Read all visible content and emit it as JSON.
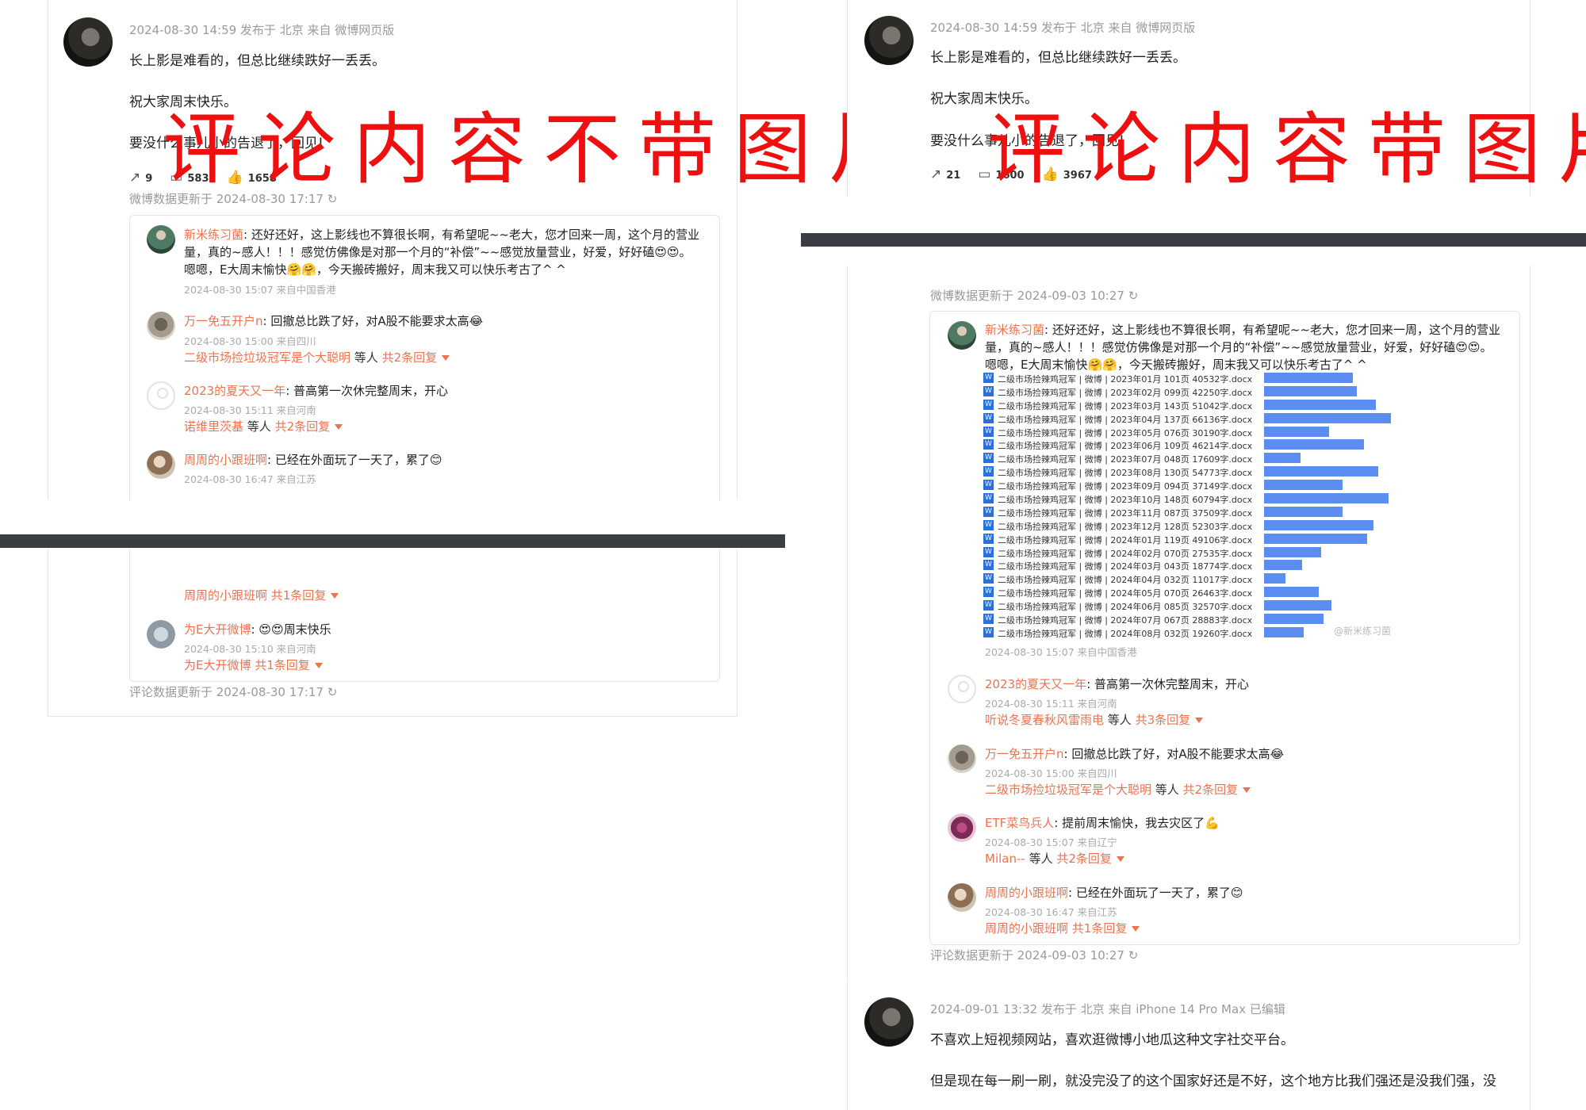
{
  "left": {
    "post": {
      "meta": "2024-08-30 14:59 发布于 北京 来自 微博网页版",
      "lines": [
        "长上影是难看的，但总比继续跌好一丢丢。",
        "祝大家周末快乐。",
        "要没什么事儿小的告退了，回见!"
      ],
      "reposts": "9",
      "comments": "583",
      "likes": "1658",
      "updated": "微博数据更新于 2024-08-30 17:17"
    },
    "overlay": "评论内容不带图片",
    "comments": [
      {
        "user": "新米练习菌",
        "text": ": 还好还好，这上影线也不算很长啊，有希望呢~~老大，您才回来一周，这个月的营业",
        "text2": "量，真的~感人！！！感觉仿佛像是对那一个月的“补偿”~~感觉放量营业，好爱，好好磕😍😍。",
        "text3": "嗯嗯，E大周末愉快🤗🤗，今天搬砖搬好，周末我又可以快乐考古了^ ^",
        "meta": "2024-08-30 15:07 来自中国香港"
      },
      {
        "user": "万一免五开户n",
        "text": ": 回撤总比跌了好，对A股不能要求太高😂",
        "meta": "2024-08-30 15:00 来自四川",
        "reply_user": "二级市场捡垃圾冠军是个大聪明",
        "reply_mid": " 等人 ",
        "reply_count": "共2条回复"
      },
      {
        "user": "2023的夏天又一年",
        "text": ": 普高第一次休完整周末，开心",
        "meta": "2024-08-30 15:11 来自河南",
        "reply_user": "诺维里茨基",
        "reply_mid": " 等人 ",
        "reply_count": "共2条回复"
      },
      {
        "user": "周周的小跟班啊",
        "text": ": 已经在外面玩了一天了，累了😊",
        "meta": "2024-08-30 16:47 来自江苏"
      }
    ],
    "bottom": {
      "reply1": "周周的小跟班啊 共1条回复",
      "comment_user": "为E大开微博",
      "comment_text": ": 😍😍周末快乐",
      "comment_meta": "2024-08-30 15:10 来自河南",
      "reply2": "为E大开微博 共1条回复",
      "updated": "评论数据更新于 2024-08-30 17:17"
    }
  },
  "right": {
    "post": {
      "meta": "2024-08-30 14:59 发布于 北京 来自 微博网页版",
      "lines": [
        "长上影是难看的，但总比继续跌好一丢丢。",
        "祝大家周末快乐。",
        "要没什么事儿小的告退了，回见!"
      ],
      "reposts": "21",
      "comments": "1600",
      "likes": "3967"
    },
    "overlay": "评论内容带图片",
    "updated_top": "微博数据更新于 2024-09-03 10:27",
    "first_comment": {
      "user": "新米练习菌",
      "text": ": 还好还好，这上影线也不算很长啊，有希望呢~~老大，您才回来一周，这个月的营业",
      "text2": "量，真的~感人！！！感觉仿佛像是对那一个月的“补偿”~~感觉放量营业，好爱，好好磕😍😍。",
      "text3": "嗯嗯，E大周末愉快🤗🤗，今天搬砖搬好，周末我又可以快乐考古了^ ^",
      "meta": "2024-08-30 15:07 来自中国香港",
      "image_watermark": "@新米练习菌"
    },
    "files": [
      {
        "name": "二级市场捡辣鸡冠军 | 微博 | 2023年01月 101页 40532字.docx",
        "bar": 0.7
      },
      {
        "name": "二级市场捡辣鸡冠军 | 微博 | 2023年02月 099页 42250字.docx",
        "bar": 0.73
      },
      {
        "name": "二级市场捡辣鸡冠军 | 微博 | 2023年03月 143页 51042字.docx",
        "bar": 0.88
      },
      {
        "name": "二级市场捡辣鸡冠军 | 微博 | 2023年04月 137页 66136字.docx",
        "bar": 1.0
      },
      {
        "name": "二级市场捡辣鸡冠军 | 微博 | 2023年05月 076页 30190字.docx",
        "bar": 0.51
      },
      {
        "name": "二级市场捡辣鸡冠军 | 微博 | 2023年06月 109页 46214字.docx",
        "bar": 0.79
      },
      {
        "name": "二级市场捡辣鸡冠军 | 微博 | 2023年07月 048页 17609字.docx",
        "bar": 0.29
      },
      {
        "name": "二级市场捡辣鸡冠军 | 微博 | 2023年08月 130页 54773字.docx",
        "bar": 0.9
      },
      {
        "name": "二级市场捡辣鸡冠军 | 微博 | 2023年09月 094页 37149字.docx",
        "bar": 0.62
      },
      {
        "name": "二级市场捡辣鸡冠军 | 微博 | 2023年10月 148页 60794字.docx",
        "bar": 0.98
      },
      {
        "name": "二级市场捡辣鸡冠军 | 微博 | 2023年11月 087页 37509字.docx",
        "bar": 0.62
      },
      {
        "name": "二级市场捡辣鸡冠军 | 微博 | 2023年12月 128页 52303字.docx",
        "bar": 0.86
      },
      {
        "name": "二级市场捡辣鸡冠军 | 微博 | 2024年01月 119页 49106字.docx",
        "bar": 0.81
      },
      {
        "name": "二级市场捡辣鸡冠军 | 微博 | 2024年02月 070页 27535字.docx",
        "bar": 0.45
      },
      {
        "name": "二级市场捡辣鸡冠军 | 微博 | 2024年03月 043页 18774字.docx",
        "bar": 0.3
      },
      {
        "name": "二级市场捡辣鸡冠军 | 微博 | 2024年04月 032页 11017字.docx",
        "bar": 0.17
      },
      {
        "name": "二级市场捡辣鸡冠军 | 微博 | 2024年05月 070页 26463字.docx",
        "bar": 0.43
      },
      {
        "name": "二级市场捡辣鸡冠军 | 微博 | 2024年06月 085页 32570字.docx",
        "bar": 0.53
      },
      {
        "name": "二级市场捡辣鸡冠军 | 微博 | 2024年07月 067页 28883字.docx",
        "bar": 0.47
      },
      {
        "name": "二级市场捡辣鸡冠军 | 微博 | 2024年08月 032页 19260字.docx",
        "bar": 0.31
      }
    ],
    "comments": [
      {
        "user": "2023的夏天又一年",
        "text": ": 普高第一次休完整周末，开心",
        "meta": "2024-08-30 15:11 来自河南",
        "reply_user": "听说冬夏春秋风雷雨电",
        "reply_mid": " 等人 ",
        "reply_count": "共3条回复"
      },
      {
        "user": "万一免五开户n",
        "text": ": 回撤总比跌了好，对A股不能要求太高😂",
        "meta": "2024-08-30 15:00 来自四川",
        "reply_user": "二级市场捡垃圾冠军是个大聪明",
        "reply_mid": " 等人 ",
        "reply_count": "共2条回复"
      },
      {
        "user": "ETF菜鸟兵人",
        "text": ": 提前周末愉快，我去灾区了💪",
        "meta": "2024-08-30 15:07 来自辽宁",
        "reply_user": "Milan--",
        "reply_mid": " 等人 ",
        "reply_count": "共2条回复"
      },
      {
        "user": "周周的小跟班啊",
        "text": ": 已经在外面玩了一天了，累了😊",
        "meta": "2024-08-30 16:47 来自江苏",
        "reply_user": "周周的小跟班啊",
        "reply_mid": " ",
        "reply_count": "共1条回复"
      }
    ],
    "updated_bottom": "评论数据更新于 2024-09-03 10:27",
    "next_post": {
      "meta": "2024-09-01 13:32 发布于 北京 来自 iPhone 14 Pro Max 已编辑",
      "line1": "不喜欢上短视频网站，喜欢逛微博小地瓜这种文字社交平台。",
      "line2": "但是现在每一刷一刷，就没完没了的这个国家好还是不好，这个地方比我们强还是没我们强，没"
    }
  }
}
